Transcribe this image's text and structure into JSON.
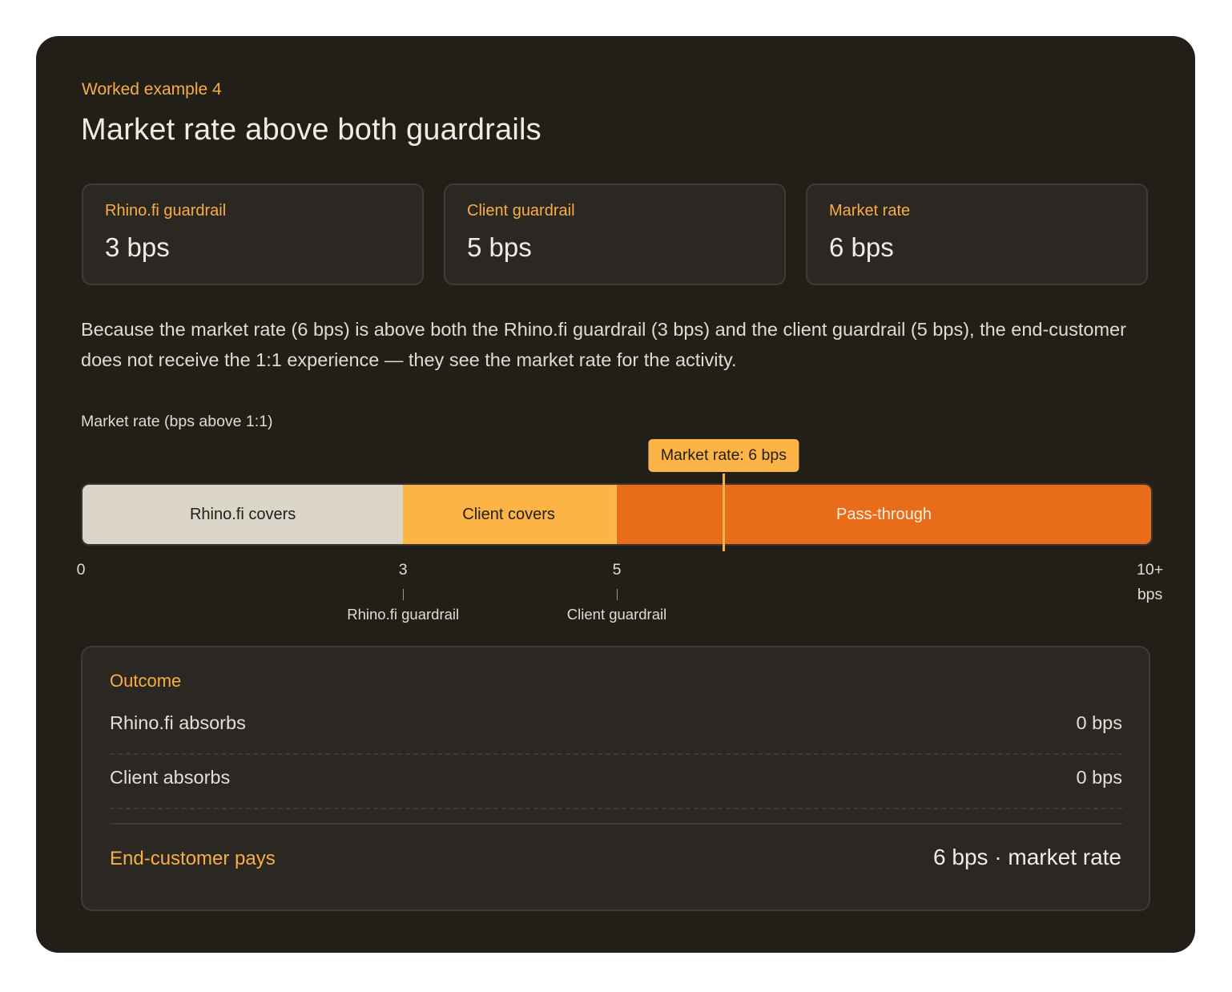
{
  "header": {
    "eyebrow": "Worked example 4",
    "title": "Market rate above both guardrails"
  },
  "stats": [
    {
      "label": "Rhino.fi guardrail",
      "value": "3 bps"
    },
    {
      "label": "Client guardrail",
      "value": "5 bps"
    },
    {
      "label": "Market rate",
      "value": "6 bps"
    }
  ],
  "description": "Because the market rate (6 bps) is above both the Rhino.fi guardrail (3 bps) and the client guardrail (5 bps), the end-customer does not receive the 1:1 experience — they see the market rate for the activity.",
  "scale": {
    "label": "Market rate (bps above 1:1)",
    "max_bps": 10,
    "segments": [
      {
        "label": "Rhino.fi covers",
        "from": 0,
        "to": 3,
        "color": "#dbd6c9"
      },
      {
        "label": "Client covers",
        "from": 3,
        "to": 5,
        "color": "#fdb446"
      },
      {
        "label": "Pass-through",
        "from": 5,
        "to": 10,
        "color": "#e86c19"
      }
    ],
    "marker": {
      "label": "Market rate: 6 bps",
      "value": 6
    },
    "ticks": [
      {
        "value": 0,
        "text": "0",
        "name": ""
      },
      {
        "value": 3,
        "text": "3",
        "name": "Rhino.fi guardrail"
      },
      {
        "value": 5,
        "text": "5",
        "name": "Client guardrail"
      }
    ],
    "end_tick": {
      "text": "10+",
      "unit": "bps"
    }
  },
  "outcome": {
    "title": "Outcome",
    "rows": [
      {
        "label": "Rhino.fi absorbs",
        "value": "0 bps"
      },
      {
        "label": "Client absorbs",
        "value": "0 bps"
      }
    ],
    "final": {
      "label": "End-customer pays",
      "value": "6 bps · market rate"
    }
  },
  "colors": {
    "accent": "#f9ad42",
    "background": "#221e18",
    "pass_through": "#e86c19"
  }
}
